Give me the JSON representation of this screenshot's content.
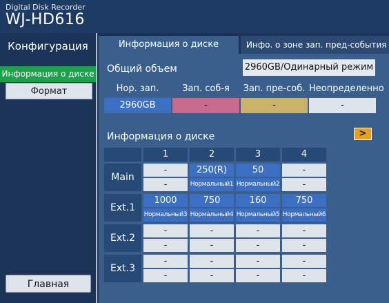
{
  "header": {
    "brand_small": "Digital Disk Recorder",
    "model": "WJ-HD616"
  },
  "sidebar": {
    "title": "Конфигурация",
    "active_item": "Информация о диске",
    "item": "Формат",
    "home_button": "Главная"
  },
  "tabs": {
    "active": "Информация о диске",
    "other": "Инфо. о зоне зап. пред-события"
  },
  "total": {
    "label": "Общий объем",
    "value": "2960GB/Одинарный режим"
  },
  "capacity": {
    "headers": [
      "Нор. зап.",
      "Зап. соб-я",
      "Зап. пре-соб.",
      "Неопределенно"
    ],
    "values": [
      "2960GB",
      "-",
      "-",
      "-"
    ],
    "colors": [
      "#3a6fc4",
      "#c76a8c",
      "#c9b36a",
      "#dde4ec"
    ]
  },
  "disk_info": {
    "label": "Информация о диске",
    "next_button": ">",
    "columns": [
      "1",
      "2",
      "3",
      "4"
    ],
    "rows": [
      {
        "name": "Main",
        "top": [
          "-",
          "250(R)",
          "50",
          "-"
        ],
        "bottom": [
          "-",
          "Нормальный1",
          "Нормальный2",
          "-"
        ]
      },
      {
        "name": "Ext.1",
        "top": [
          "1000",
          "750",
          "160",
          "750"
        ],
        "bottom": [
          "Нормальный3",
          "Нормальный4",
          "Нормальный5",
          "Нормальный6"
        ]
      },
      {
        "name": "Ext.2",
        "top": [
          "-",
          "-",
          "-",
          "-"
        ],
        "bottom": [
          "-",
          "-",
          "-",
          "-"
        ]
      },
      {
        "name": "Ext.3",
        "top": [
          "-",
          "-",
          "-",
          "-"
        ],
        "bottom": [
          "-",
          "-",
          "-",
          "-"
        ]
      }
    ]
  }
}
